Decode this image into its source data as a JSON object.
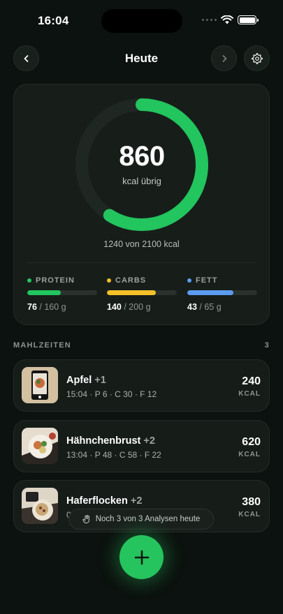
{
  "status_bar": {
    "time": "16:04"
  },
  "nav": {
    "title": "Heute"
  },
  "summary": {
    "remaining_value": "860",
    "remaining_label": "kcal übrig",
    "total_text": "1240 von 2100 kcal",
    "consumed_fraction": 0.59,
    "accent_color": "#22c55e"
  },
  "macros": [
    {
      "label": "PROTEIN",
      "current": "76",
      "total": " / 160 g",
      "fraction": 0.475,
      "color": "#22c55e"
    },
    {
      "label": "CARBS",
      "current": "140",
      "total": " / 200 g",
      "fraction": 0.7,
      "color": "#f5c028"
    },
    {
      "label": "FETT",
      "current": "43",
      "total": " / 65 g",
      "fraction": 0.66,
      "color": "#5b9cf0"
    }
  ],
  "meals_section": {
    "title": "MAHLZEITEN",
    "count": "3"
  },
  "meals": [
    {
      "name": "Apfel",
      "extra": " +1",
      "time_macros": "15:04 · P 6 · C 30 · F 12",
      "kcal": "240",
      "unit": "KCAL"
    },
    {
      "name": "Hähnchenbrust",
      "extra": " +2",
      "time_macros": "13:04 · P 48 · C 58 · F 22",
      "kcal": "620",
      "unit": "KCAL"
    },
    {
      "name": "Haferflocken",
      "extra": " +2",
      "time_macros": "0",
      "kcal": "380",
      "unit": "KCAL"
    }
  ],
  "toast": {
    "text": "Noch 3 von 3 Analysen heute"
  },
  "icons": {
    "back": "chevron-left-icon",
    "next": "chevron-right-icon",
    "settings": "gear-icon",
    "add": "plus-icon",
    "toast": "hand-icon"
  }
}
